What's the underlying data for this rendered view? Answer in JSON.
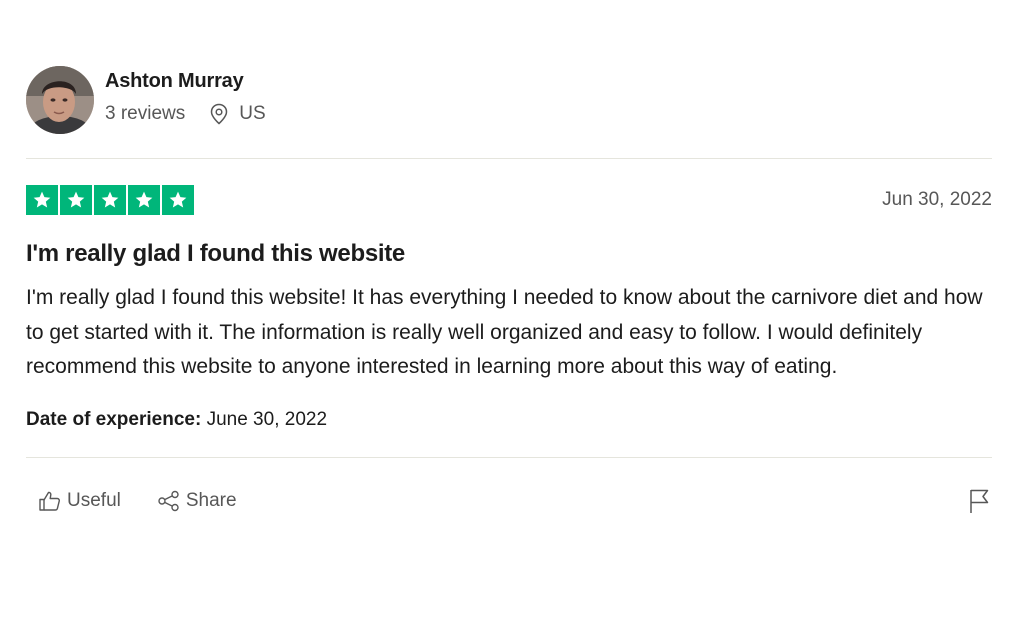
{
  "reviewer": {
    "name": "Ashton Murray",
    "reviews_count": "3 reviews",
    "country": "US",
    "avatar_icon": "user-photo"
  },
  "review": {
    "rating": 5,
    "rating_max": 5,
    "star_color": "#00b67a",
    "date": "Jun 30, 2022",
    "title": "I'm really glad I found this website",
    "body": "I'm really glad I found this website! It has everything I needed to know about the carnivore diet and how to get started with it. The information is really well organized and easy to follow. I would definitely recommend this website to anyone interested in learning more about this way of eating.",
    "experience_label": "Date of experience:",
    "experience_date": "June 30, 2022"
  },
  "actions": {
    "useful_label": "Useful",
    "share_label": "Share",
    "useful_icon": "thumbs-up-icon",
    "share_icon": "share-icon",
    "flag_icon": "flag-icon"
  }
}
